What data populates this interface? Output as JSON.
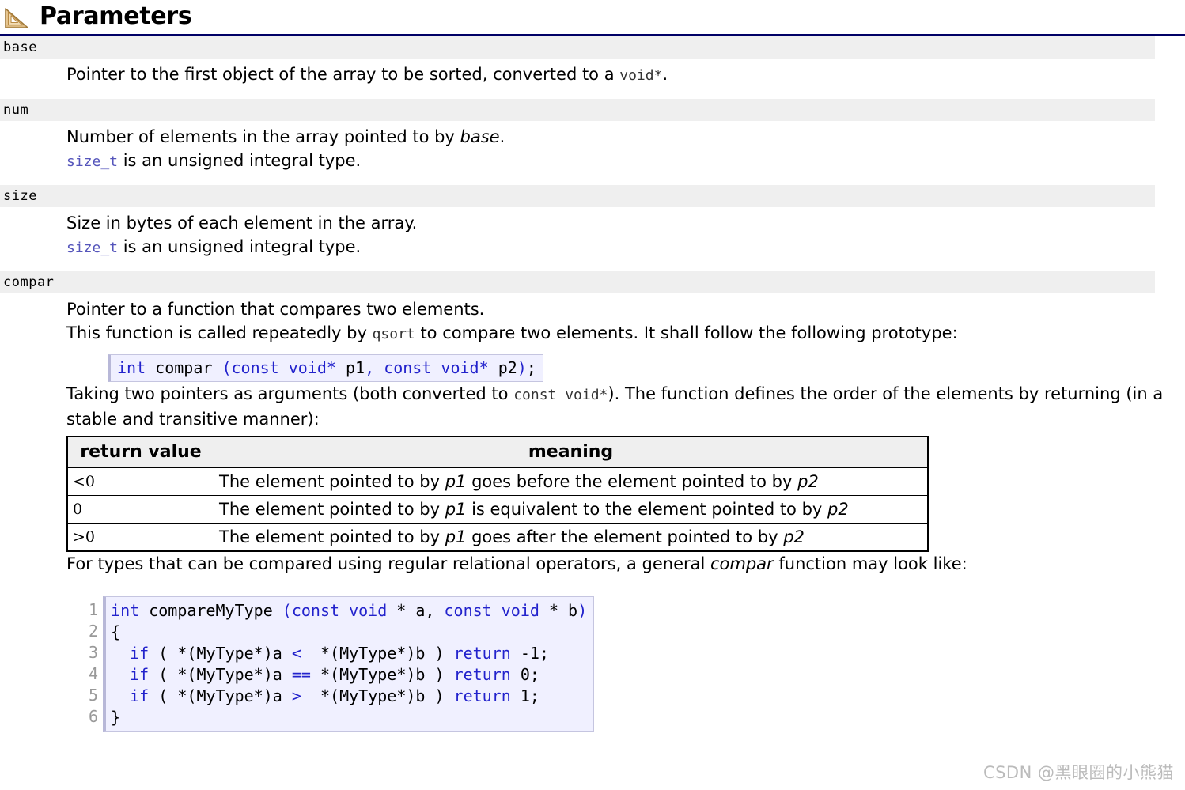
{
  "header": {
    "title": "Parameters",
    "icon": "set-square-ruler-icon",
    "rule_color": "#000066"
  },
  "colors": {
    "band_background": "#efefef",
    "code_background": "#f0f0ff",
    "code_border": "#c5c5e0",
    "keyword_blue": "#2222cc",
    "link_blue": "#5555bb",
    "gutter_gray": "#999999",
    "watermark_gray": "#bbbbbb"
  },
  "parameters": [
    {
      "name": "base",
      "lines": [
        {
          "parts": [
            {
              "text": "Pointer to the first object of the array to be sorted, converted to a ",
              "style": "normal"
            },
            {
              "text": "void*",
              "style": "mono-gray"
            },
            {
              "text": ".",
              "style": "normal"
            }
          ]
        }
      ]
    },
    {
      "name": "num",
      "lines": [
        {
          "parts": [
            {
              "text": "Number of elements in the array pointed to by ",
              "style": "normal"
            },
            {
              "text": "base",
              "style": "italic"
            },
            {
              "text": ".",
              "style": "normal"
            }
          ]
        },
        {
          "parts": [
            {
              "text": "size_t",
              "style": "mono-blue"
            },
            {
              "text": " is an unsigned integral type.",
              "style": "normal"
            }
          ]
        }
      ]
    },
    {
      "name": "size",
      "lines": [
        {
          "parts": [
            {
              "text": "Size in bytes of each element in the array.",
              "style": "normal"
            }
          ]
        },
        {
          "parts": [
            {
              "text": "size_t",
              "style": "mono-blue"
            },
            {
              "text": " is an unsigned integral type.",
              "style": "normal"
            }
          ]
        }
      ]
    },
    {
      "name": "compar",
      "lines": [
        {
          "parts": [
            {
              "text": "Pointer to a function that compares two elements.",
              "style": "normal"
            }
          ]
        },
        {
          "parts": [
            {
              "text": "This function is called repeatedly by ",
              "style": "normal"
            },
            {
              "text": "qsort",
              "style": "mono-gray"
            },
            {
              "text": " to compare two elements. It shall follow the following prototype:",
              "style": "normal"
            }
          ]
        }
      ]
    }
  ],
  "prototype_code": {
    "tokens": [
      {
        "t": "int",
        "k": true
      },
      {
        "t": " compar ",
        "k": false
      },
      {
        "t": "(",
        "k": true
      },
      {
        "t": "const void",
        "k": true
      },
      {
        "t": "*",
        "k": true
      },
      {
        "t": " p1",
        "k": false
      },
      {
        "t": ", ",
        "k": true
      },
      {
        "t": "const void",
        "k": true
      },
      {
        "t": "*",
        "k": true
      },
      {
        "t": " p2",
        "k": false
      },
      {
        "t": ")",
        "k": true
      },
      {
        "t": ";",
        "k": false
      }
    ],
    "plain_text": "int compar (const void* p1, const void* p2);"
  },
  "paragraphs": {
    "taking_two_pointers": {
      "part1": "Taking two pointers as arguments (both converted to ",
      "code": "const void*",
      "part2": "). The function defines the order of the elements by returning (in a stable and transitive manner):"
    },
    "for_types": {
      "part1": "For types that can be compared using regular relational operators, a general ",
      "emphasis": "compar",
      "part2": " function may look like:"
    }
  },
  "return_table": {
    "headers": [
      "return value",
      "meaning"
    ],
    "rows": [
      {
        "value": "<0",
        "meaning_parts": [
          {
            "text": "The element pointed to by ",
            "style": "normal"
          },
          {
            "text": "p1",
            "style": "italic"
          },
          {
            "text": " goes before the element pointed to by ",
            "style": "normal"
          },
          {
            "text": "p2",
            "style": "italic"
          }
        ]
      },
      {
        "value": "0",
        "meaning_parts": [
          {
            "text": "The element pointed to by ",
            "style": "normal"
          },
          {
            "text": "p1",
            "style": "italic"
          },
          {
            "text": " is equivalent to the element pointed to by ",
            "style": "normal"
          },
          {
            "text": "p2",
            "style": "italic"
          }
        ]
      },
      {
        "value": ">0",
        "meaning_parts": [
          {
            "text": "The element pointed to by ",
            "style": "normal"
          },
          {
            "text": "p1",
            "style": "italic"
          },
          {
            "text": " goes after the element pointed to by ",
            "style": "normal"
          },
          {
            "text": "p2",
            "style": "italic"
          }
        ]
      }
    ]
  },
  "example_code": {
    "line_numbers": [
      "1",
      "2",
      "3",
      "4",
      "5",
      "6"
    ],
    "lines": [
      [
        {
          "t": "int",
          "k": true
        },
        {
          "t": " compareMyType ",
          "k": false
        },
        {
          "t": "(",
          "k": true
        },
        {
          "t": "const void",
          "k": true
        },
        {
          "t": " * a, ",
          "k": false
        },
        {
          "t": "const void",
          "k": true
        },
        {
          "t": " * b",
          "k": false
        },
        {
          "t": ")",
          "k": true
        }
      ],
      [
        {
          "t": "{",
          "k": false
        }
      ],
      [
        {
          "t": "  ",
          "k": false
        },
        {
          "t": "if",
          "k": true
        },
        {
          "t": " ( *(MyType*)a ",
          "k": false
        },
        {
          "t": "<",
          "k": true
        },
        {
          "t": "  *(MyType*)b ) ",
          "k": false
        },
        {
          "t": "return",
          "k": true
        },
        {
          "t": " -1;",
          "k": false
        }
      ],
      [
        {
          "t": "  ",
          "k": false
        },
        {
          "t": "if",
          "k": true
        },
        {
          "t": " ( *(MyType*)a ",
          "k": false
        },
        {
          "t": "==",
          "k": true
        },
        {
          "t": " *(MyType*)b ) ",
          "k": false
        },
        {
          "t": "return",
          "k": true
        },
        {
          "t": " 0;",
          "k": false
        }
      ],
      [
        {
          "t": "  ",
          "k": false
        },
        {
          "t": "if",
          "k": true
        },
        {
          "t": " ( *(MyType*)a ",
          "k": false
        },
        {
          "t": ">",
          "k": true
        },
        {
          "t": "  *(MyType*)b ) ",
          "k": false
        },
        {
          "t": "return",
          "k": true
        },
        {
          "t": " 1;",
          "k": false
        }
      ],
      [
        {
          "t": "}",
          "k": false
        }
      ]
    ],
    "plain_text": "int compareMyType (const void * a, const void * b)\n{\n  if ( *(MyType*)a <  *(MyType*)b ) return -1;\n  if ( *(MyType*)a == *(MyType*)b ) return 0;\n  if ( *(MyType*)a >  *(MyType*)b ) return 1;\n}"
  },
  "watermark": {
    "text": "CSDN @黑眼圈的小熊猫"
  }
}
